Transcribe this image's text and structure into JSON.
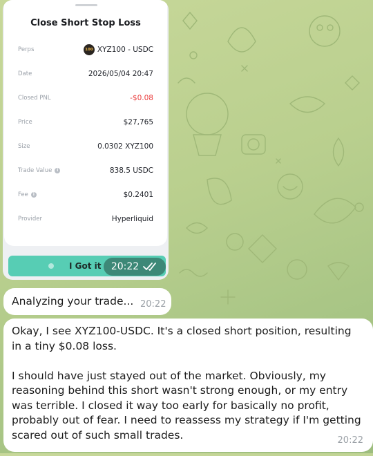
{
  "image_message": {
    "card": {
      "title": "Close Short Stop Loss",
      "rows": [
        {
          "label": "Perps",
          "value": "XYZ100 - USDC",
          "coin_badge": "100"
        },
        {
          "label": "Date",
          "value": "2026/05/04 20:47"
        },
        {
          "label": "Closed PNL",
          "value": "-$0.08",
          "negative": true
        },
        {
          "label": "Price",
          "value": "$27,765"
        },
        {
          "label": "Size",
          "value": "0.0302 XYZ100"
        },
        {
          "label": "Trade Value",
          "value": "838.5 USDC",
          "info": true
        },
        {
          "label": "Fee",
          "value": "$0.2401",
          "info": true
        },
        {
          "label": "Provider",
          "value": "Hyperliquid"
        }
      ],
      "button_label": "I Got it",
      "accent_color": "#57cdb4",
      "negative_color": "#ea3b3b"
    },
    "time": "20:22",
    "status_icon": "double-check-icon"
  },
  "messages": [
    {
      "text": "Analyzing your trade...",
      "time": "20:22"
    },
    {
      "text": "Okay, I see XYZ100-USDC. It's a closed short position, resulting in a tiny $0.08 loss.\n\nI should have just stayed out of the market. Obviously, my reasoning behind this short wasn't strong enough, or my entry was terrible. I closed it way too early for basically no profit, probably out of fear. I need to reassess my strategy if I'm getting scared out of such small trades.",
      "time": "20:22"
    }
  ],
  "background_color": "#b9cf8e"
}
